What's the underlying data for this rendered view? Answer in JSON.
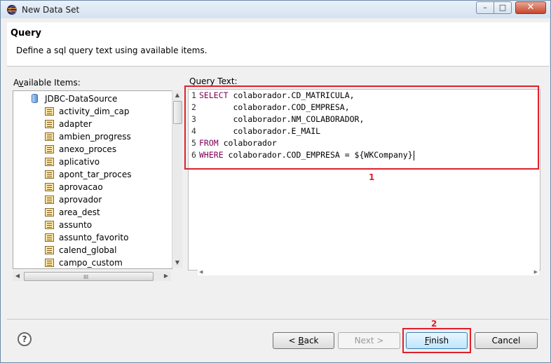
{
  "window": {
    "title": "New Data Set",
    "controls": {
      "minimize": "–",
      "maximize": "□",
      "close": "✕"
    },
    "title_icon": "eclipse-logo-icon"
  },
  "header": {
    "title": "Query",
    "description": "Define a sql query text using available items."
  },
  "available_items": {
    "label": "Available Items:",
    "root": {
      "label": "JDBC-DataSource",
      "icon": "datasource-icon"
    },
    "items": [
      "activity_dim_cap",
      "adapter",
      "ambien_progress",
      "anexo_proces",
      "aplicativo",
      "apont_tar_proces",
      "aprovacao",
      "aprovador",
      "area_dest",
      "assunto",
      "assunto_favorito",
      "calend_global",
      "campo_custom"
    ],
    "item_icon": "table-icon",
    "hscroll_grip": "III"
  },
  "query": {
    "label": "Query Text:",
    "lines": [
      {
        "num": "1",
        "kw": "SELECT",
        "rest": " colaborador.CD_MATRICULA,"
      },
      {
        "num": "2",
        "kw": "",
        "rest": "       colaborador.COD_EMPRESA,"
      },
      {
        "num": "3",
        "kw": "",
        "rest": "       colaborador.NM_COLABORADOR,"
      },
      {
        "num": "4",
        "kw": "",
        "rest": "       colaborador.E_MAIL"
      },
      {
        "num": "5",
        "kw": "FROM",
        "rest": " colaborador"
      },
      {
        "num": "6",
        "kw": "WHERE",
        "rest": " colaborador.COD_EMPRESA = ${WKCompany}"
      }
    ]
  },
  "annotations": {
    "query_marker": "1",
    "finish_marker": "2",
    "color": "#e0202a"
  },
  "buttons": {
    "help": "?",
    "back": "< Back",
    "next": "Next >",
    "finish": "Finish",
    "cancel": "Cancel"
  },
  "colors": {
    "keyword": "#7f0055",
    "accent": "#3c7fb1"
  }
}
